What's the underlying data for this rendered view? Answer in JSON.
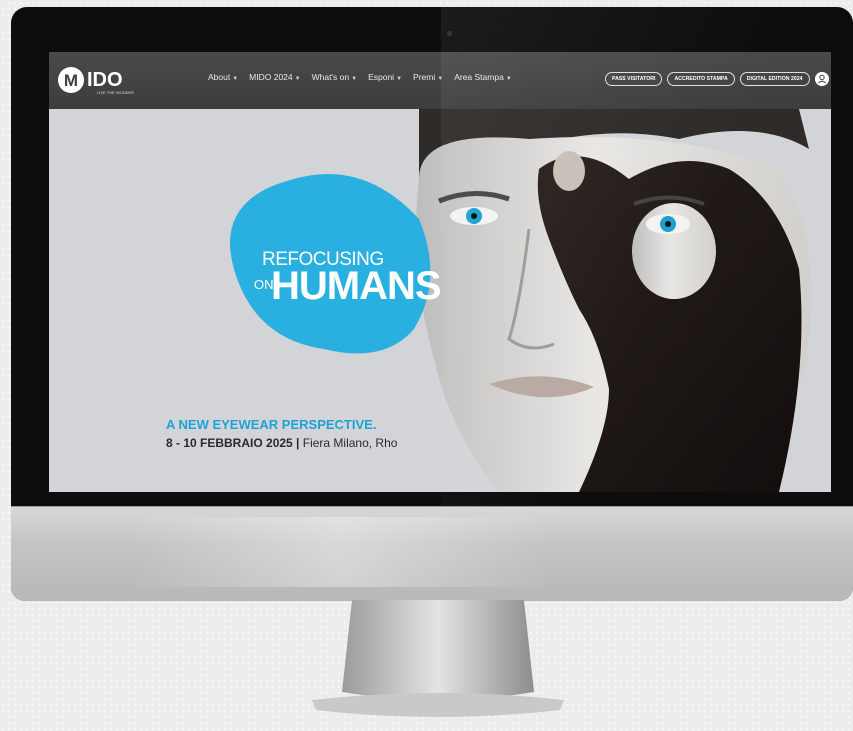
{
  "logo": {
    "word": "IDO",
    "letter": "M",
    "tagline": "LIVE THE WONDER"
  },
  "nav": {
    "items": [
      {
        "label": "About"
      },
      {
        "label": "MIDO 2024"
      },
      {
        "label": "What's on"
      },
      {
        "label": "Esponi"
      },
      {
        "label": "Premi"
      },
      {
        "label": "Area Stampa"
      }
    ],
    "buttons": [
      {
        "label": "PASS VISITATORI"
      },
      {
        "label": "ACCREDITO STAMPA"
      },
      {
        "label": "DIGITAL EDITION 2024"
      }
    ],
    "icons": [
      "user-icon",
      "search-icon"
    ]
  },
  "hero": {
    "headline_top": "REFOCUSING",
    "headline_on": "ON",
    "headline_main": "HUMANS",
    "tagline": "A NEW EYEWEAR PERSPECTIVE.",
    "dates_bold": "8 - 10 FEBBRAIO 2025 |",
    "venue": " Fiera Milano, Rho"
  },
  "colors": {
    "accent": "#1fa3d4",
    "blob": "#2ab0e0",
    "nav_bg": "#444444"
  }
}
